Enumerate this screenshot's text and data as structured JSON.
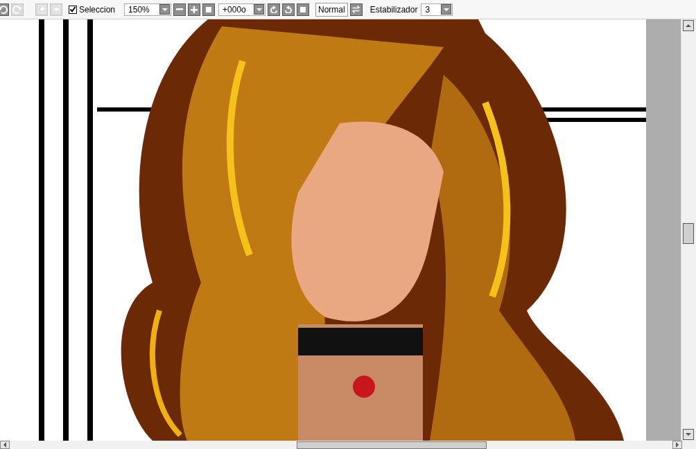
{
  "toolbar": [
    {
      "kind": "icon",
      "disabled": false
    },
    {
      "kind": "icon",
      "disabled": true
    },
    {
      "kind": "icon",
      "disabled": true
    },
    {
      "kind": "icon",
      "disabled": true
    },
    {
      "kind": "checkbox",
      "label": "Seleccion",
      "checked": true
    },
    {
      "kind": "dropdown",
      "value": "150%"
    },
    {
      "kind": "icon",
      "disabled": false
    },
    {
      "kind": "icon",
      "disabled": false
    },
    {
      "kind": "icon",
      "disabled": false
    },
    {
      "kind": "dropdown",
      "value": "+000o"
    },
    {
      "kind": "icon",
      "disabled": false
    },
    {
      "kind": "icon",
      "disabled": false
    },
    {
      "kind": "icon",
      "disabled": false
    },
    {
      "kind": "textbutton",
      "label": "Normal"
    },
    {
      "kind": "icon",
      "disabled": false
    },
    {
      "kind": "label",
      "label": "Estabilizador"
    },
    {
      "kind": "dropdown",
      "value": "3"
    }
  ]
}
